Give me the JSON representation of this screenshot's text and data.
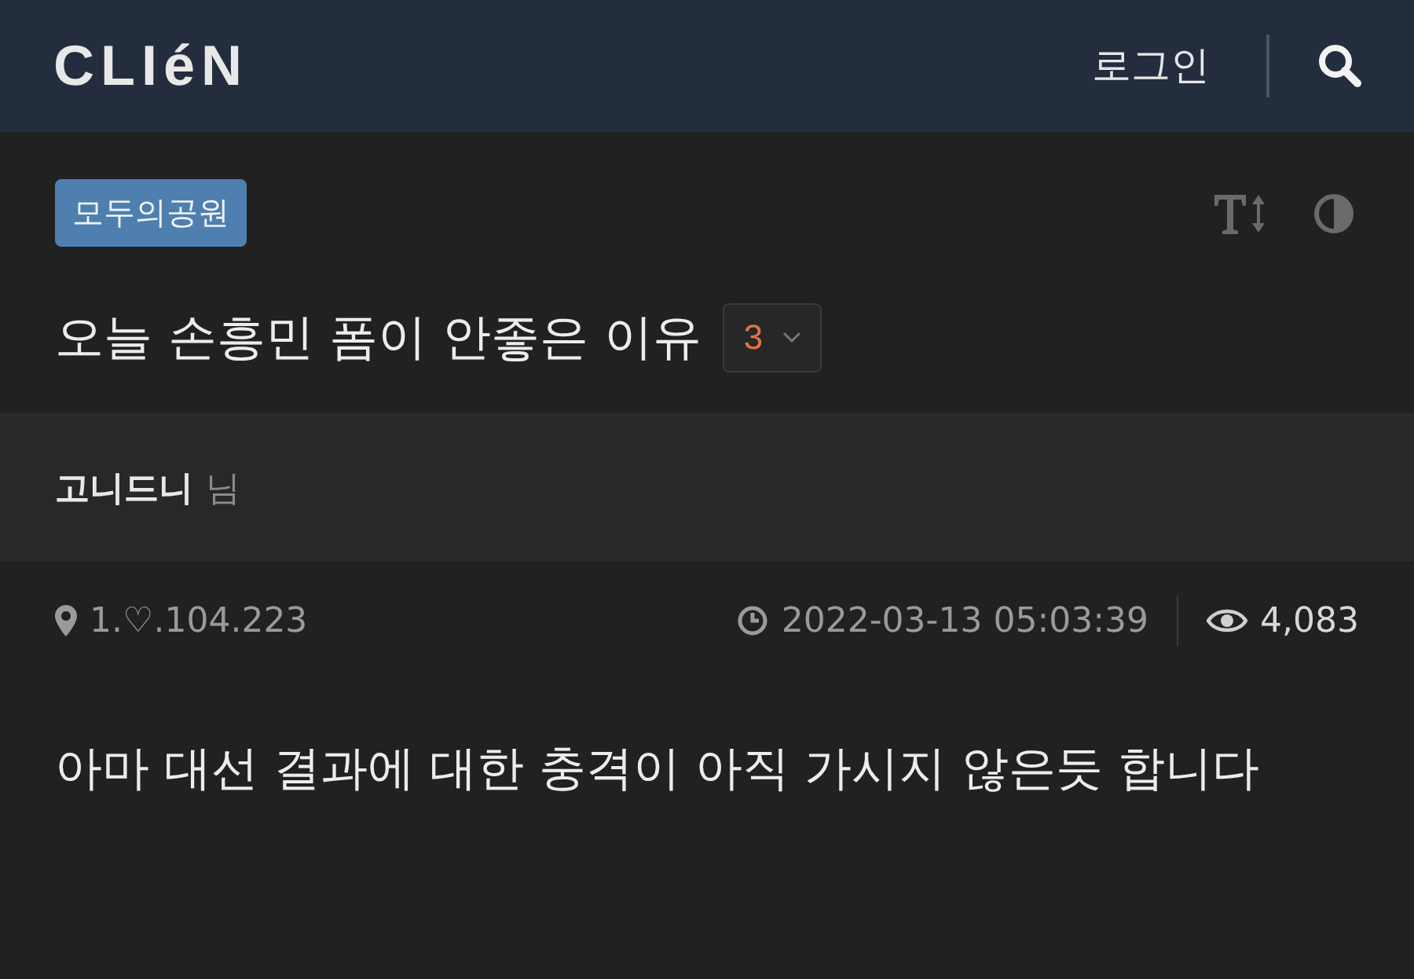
{
  "header": {
    "logo": "CLIéN",
    "login": "로그인"
  },
  "post": {
    "category": "모두의공원",
    "title": "오늘 손흥민 폼이 안좋은 이유",
    "comment_count": "3",
    "author": "고니드니",
    "author_suffix": "님",
    "ip": "1.♡.104.223",
    "datetime": "2022-03-13 05:03:39",
    "views": "4,083",
    "body": "아마 대선 결과에 대한 충격이 아직 가시지 않은듯 합니다"
  }
}
